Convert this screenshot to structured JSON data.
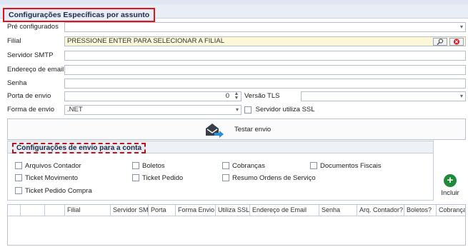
{
  "header": {
    "title": "Configurações Específicas por assunto"
  },
  "form": {
    "pre_config_label": "Pré configurados",
    "pre_config_value": "",
    "filial_label": "Filial",
    "filial_value": "PRESSIONE ENTER PARA SELECIONAR A FILIAL",
    "smtp_label": "Servidor SMTP",
    "smtp_value": "",
    "email_label": "Endereço de email",
    "email_value": "",
    "senha_label": "Senha",
    "senha_value": "",
    "porta_label": "Porta de envio",
    "porta_value": "0",
    "tls_label": "Versão TLS",
    "tls_value": "",
    "forma_label": "Forma de envio",
    "forma_value": ".NET",
    "ssl_label": "Servidor utiliza SSL"
  },
  "test_button": {
    "label": "Testar envio"
  },
  "group": {
    "title": "Configurações de envio para a conta",
    "checkboxes": [
      "Arquivos Contador",
      "Boletos",
      "Cobranças",
      "Documentos Fiscais",
      "Ticket Movimento",
      "Ticket Pedido",
      "Resumo Ordens de Serviço",
      "Ticket Pedido Compra"
    ]
  },
  "incluir": {
    "label": "Incluir"
  },
  "grid": {
    "columns": [
      "Filial",
      "Servidor SMTP",
      "Porta",
      "Forma Envio",
      "Utiliza SSL",
      "Endereço de Email",
      "Senha",
      "Arq. Contador?",
      "Boletos?",
      "Cobranças"
    ]
  },
  "colors": {
    "accent_red": "#e1141b",
    "header_bg": "#e9eef6",
    "filial_bg": "#fbf8d8",
    "incluir_green": "#1f8a3a"
  },
  "icons": [
    "search-icon",
    "clear-icon",
    "mail-send-icon",
    "plus-icon",
    "chevron-down-icon"
  ]
}
